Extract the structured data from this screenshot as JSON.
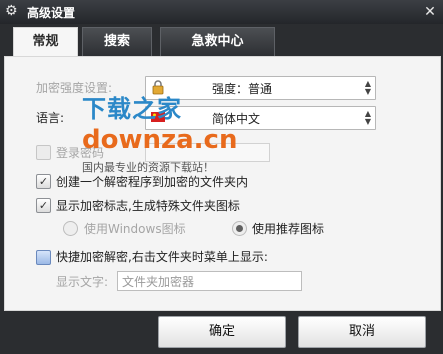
{
  "window": {
    "title": "高级设置",
    "close": "✕"
  },
  "tabs": [
    {
      "label": "常规",
      "active": true
    },
    {
      "label": "搜索",
      "active": false
    },
    {
      "label": "急救中心",
      "active": false
    }
  ],
  "general": {
    "encrypt_strength_label": "加密强度设置:",
    "encrypt_strength_value": "强度：普通",
    "language_label": "语言:",
    "language_value": "简体中文",
    "login_password_label": "登录密码",
    "create_decryptor_label": "创建一个解密程序到加密的文件夹内",
    "create_decryptor_checked": true,
    "show_flag_label": "显示加密标志,生成特殊文件夹图标",
    "show_flag_checked": true,
    "radio_windows_label": "使用Windows图标",
    "radio_recommended_label": "使用推荐图标",
    "radio_selected": "recommended",
    "quick_decrypt_label": "快捷加密解密,右击文件夹时菜单上显示:",
    "display_text_label": "显示文字:",
    "display_text_value": "文件夹加密器"
  },
  "watermark": {
    "cn": "下载之家",
    "en": "downza.cn",
    "sub": "国内最专业的资源下载站！"
  },
  "buttons": {
    "ok": "确定",
    "cancel": "取消"
  },
  "colors": {
    "titlebar": "#2b2d30",
    "panel": "#f4f4f4",
    "watermark_blue": "#2b88c8",
    "watermark_orange": "#e86a1c"
  }
}
